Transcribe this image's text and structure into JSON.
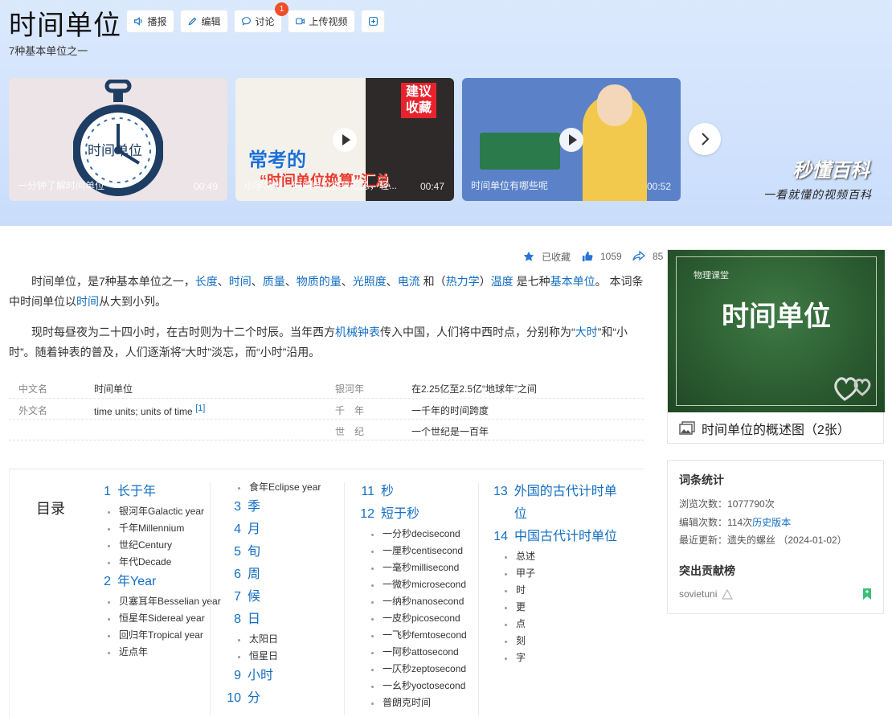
{
  "header": {
    "title": "时间单位",
    "subtitle": "7种基本单位之一",
    "buttons": {
      "broadcast": "播报",
      "edit": "编辑",
      "discuss": "讨论",
      "upload": "上传视频",
      "add": "+"
    },
    "discuss_badge": "1"
  },
  "videos": [
    {
      "caption": "一分钟了解时间单位",
      "duration": "00:49",
      "overlay": "时间单位"
    },
    {
      "caption": "小学常考：时间单位换算汇总，轻...",
      "duration": "00:47",
      "overlay_top": "建议收藏",
      "overlay_main": "常考的",
      "overlay_sub": "“时间单位换算”汇总"
    },
    {
      "caption": "时间单位有哪些呢",
      "duration": "00:52"
    }
  ],
  "brand": {
    "logo": "秒懂百科",
    "slogan": "一看就懂的视频百科"
  },
  "actions": {
    "collected": "已收藏",
    "likes": "1059",
    "shares": "85"
  },
  "intro": {
    "p1": [
      {
        "t": "时间单位，是7种基本单位之一，"
      },
      {
        "t": "长度",
        "link": true
      },
      {
        "t": "、"
      },
      {
        "t": "时间",
        "link": true
      },
      {
        "t": "、"
      },
      {
        "t": "质量",
        "link": true
      },
      {
        "t": "、"
      },
      {
        "t": "物质的量",
        "link": true
      },
      {
        "t": "、"
      },
      {
        "t": "光照度",
        "link": true
      },
      {
        "t": "、"
      },
      {
        "t": "电流",
        "link": true
      },
      {
        "t": " 和（"
      },
      {
        "t": "热力学",
        "link": true
      },
      {
        "t": "）"
      },
      {
        "t": "温度",
        "link": true
      },
      {
        "t": " 是七种"
      },
      {
        "t": "基本单位",
        "link": true
      },
      {
        "t": "。 本词条中时间单位以"
      },
      {
        "t": "时间",
        "link": true
      },
      {
        "t": "从大到小列。"
      }
    ],
    "p2": [
      {
        "t": "现时每昼夜为二十四小时，在古时则为十二个时辰。当年西方"
      },
      {
        "t": "机械钟表",
        "link": true
      },
      {
        "t": "传入中国，人们将中西时点，分别称为“"
      },
      {
        "t": "大时",
        "link": true
      },
      {
        "t": "”和“小时”。随着钟表的普及，人们逐渐将“大时”淡忘，而“小时”沿用。"
      }
    ]
  },
  "infobox": {
    "left": [
      {
        "k": "中文名",
        "v": "时间单位"
      },
      {
        "k": "外文名",
        "v": "time units; units of time",
        "ref": "[1]"
      }
    ],
    "right": [
      {
        "k": "银河年",
        "v": "在2.25亿至2.5亿“地球年”之间"
      },
      {
        "k": "千　年",
        "v": "一千年的时间跨度"
      },
      {
        "k": "世　纪",
        "v": "一个世纪是一百年"
      }
    ]
  },
  "toc": {
    "title": "目录",
    "col1": [
      {
        "n": "1",
        "t": "长于年",
        "subs": [
          "银河年Galactic year",
          "千年Millennium",
          "世纪Century",
          "年代Decade"
        ]
      },
      {
        "n": "2",
        "t": "年Year",
        "subs": [
          "贝塞耳年Besselian year",
          "恒星年Sidereal year",
          "回归年Tropical year",
          "近点年"
        ]
      }
    ],
    "col2_top": [
      "食年Eclipse year"
    ],
    "col2": [
      {
        "n": "3",
        "t": "季"
      },
      {
        "n": "4",
        "t": "月"
      },
      {
        "n": "5",
        "t": "旬"
      },
      {
        "n": "6",
        "t": "周"
      },
      {
        "n": "7",
        "t": "候"
      },
      {
        "n": "8",
        "t": "日",
        "subs": [
          "太阳日",
          "恒星日"
        ]
      },
      {
        "n": "9",
        "t": "小时"
      },
      {
        "n": "10",
        "t": "分"
      }
    ],
    "col3": [
      {
        "n": "11",
        "t": "秒"
      },
      {
        "n": "12",
        "t": "短于秒",
        "subs": [
          "一分秒decisecond",
          "一厘秒centisecond",
          "一毫秒millisecond",
          "一微秒microsecond",
          "一纳秒nanosecond",
          "一皮秒picosecond",
          "一飞秒femtosecond",
          "一阿秒attosecond",
          "一仄秒zeptosecond",
          "一幺秒yoctosecond",
          "普朗克时间"
        ]
      }
    ],
    "col4": [
      {
        "n": "13",
        "t": "外国的古代计时单位"
      },
      {
        "n": "14",
        "t": "中国古代计时单位",
        "subs": [
          "总述",
          "甲子",
          "时",
          "更",
          "点",
          "刻",
          "字"
        ]
      }
    ]
  },
  "side_image": {
    "tag": "物理课堂",
    "title": "时间单位",
    "caption": "时间单位的概述图（2张）"
  },
  "stats": {
    "title": "词条统计",
    "views_label": "浏览次数：",
    "views": "1077790次",
    "edits_label": "编辑次数：",
    "edits": "114次",
    "history": "历史版本",
    "updated_label": "最近更新：",
    "updated": "遗失的螺丝 （2024-01-02）",
    "contrib_title": "突出贡献榜",
    "contributor": "sovietuni"
  }
}
